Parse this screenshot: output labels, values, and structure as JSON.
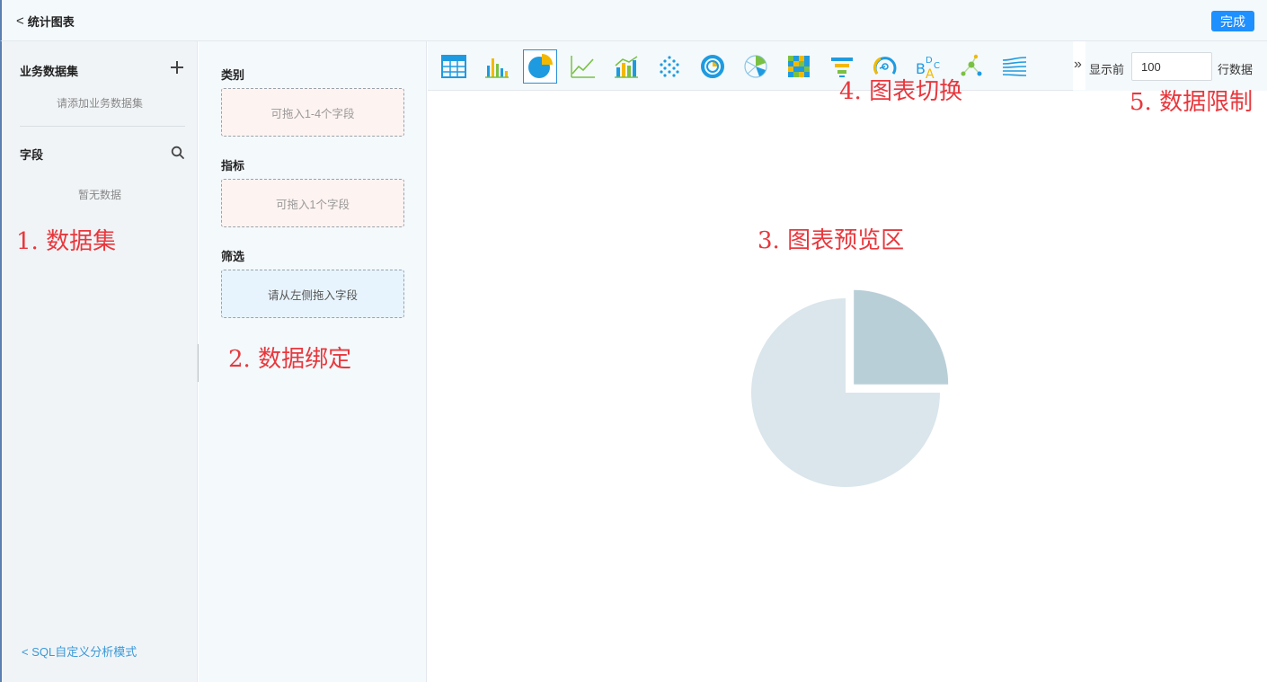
{
  "header": {
    "title": "统计图表",
    "done_label": "完成"
  },
  "left_panel": {
    "dataset_title": "业务数据集",
    "dataset_hint": "请添加业务数据集",
    "fields_title": "字段",
    "fields_empty": "暂无数据",
    "sql_link": "< SQL自定义分析模式"
  },
  "binding": {
    "category_label": "类别",
    "category_hint": "可拖入1-4个字段",
    "metric_label": "指标",
    "metric_hint": "可拖入1个字段",
    "filter_label": "筛选",
    "filter_hint": "请从左侧拖入字段"
  },
  "toolbar": {
    "chart_types": [
      "table-icon",
      "bar-chart-icon",
      "pie-chart-icon",
      "line-chart-icon",
      "combo-chart-icon",
      "scatter-chart-icon",
      "ring-chart-icon",
      "rose-chart-icon",
      "heatmap-icon",
      "funnel-chart-icon",
      "gauge-chart-icon",
      "word-cloud-icon",
      "network-chart-icon",
      "sankey-chart-icon"
    ],
    "selected_chart": "pie-chart-icon",
    "show_prefix": "显示前",
    "rows_value": "100",
    "show_suffix": "行数据"
  },
  "annotations": {
    "a1": "1.  数据集",
    "a2": "2.  数据绑定",
    "a3": "3.  图表预览区",
    "a4": "4.  图表切换",
    "a5": "5.  数据限制"
  },
  "chart_data": {
    "type": "pie",
    "values": [
      25,
      75
    ],
    "colors": [
      "#b9cfd8",
      "#dae6eb"
    ],
    "title": "",
    "exploded_slice": 0
  }
}
